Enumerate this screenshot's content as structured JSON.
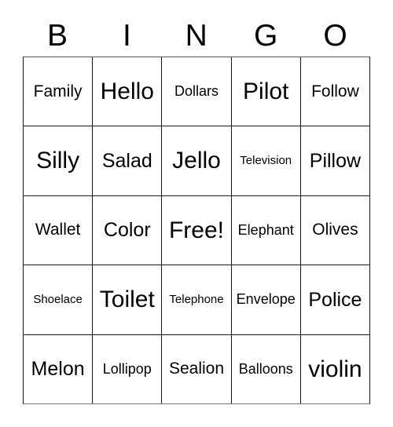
{
  "card": {
    "title": "BINGO",
    "headers": [
      {
        "label": "B"
      },
      {
        "label": "I"
      },
      {
        "label": "N"
      },
      {
        "label": "G"
      },
      {
        "label": "O"
      }
    ],
    "rows": [
      {
        "cells": [
          {
            "label": "Family",
            "size": "m"
          },
          {
            "label": "Hello",
            "size": "xl"
          },
          {
            "label": "Dollars",
            "size": "s"
          },
          {
            "label": "Pilot",
            "size": "xl"
          },
          {
            "label": "Follow",
            "size": "m"
          }
        ]
      },
      {
        "cells": [
          {
            "label": "Silly",
            "size": "xl"
          },
          {
            "label": "Salad",
            "size": "l"
          },
          {
            "label": "Jello",
            "size": "xl"
          },
          {
            "label": "Television",
            "size": "xs"
          },
          {
            "label": "Pillow",
            "size": "l"
          }
        ]
      },
      {
        "cells": [
          {
            "label": "Wallet",
            "size": "m"
          },
          {
            "label": "Color",
            "size": "l"
          },
          {
            "label": "Free!",
            "size": "xl"
          },
          {
            "label": "Elephant",
            "size": "s"
          },
          {
            "label": "Olives",
            "size": "m"
          }
        ]
      },
      {
        "cells": [
          {
            "label": "Shoelace",
            "size": "xs"
          },
          {
            "label": "Toilet",
            "size": "xl"
          },
          {
            "label": "Telephone",
            "size": "xs"
          },
          {
            "label": "Envelope",
            "size": "s"
          },
          {
            "label": "Police",
            "size": "l"
          }
        ]
      },
      {
        "cells": [
          {
            "label": "Melon",
            "size": "l"
          },
          {
            "label": "Lollipop",
            "size": "s"
          },
          {
            "label": "Sealion",
            "size": "m"
          },
          {
            "label": "Balloons",
            "size": "s"
          },
          {
            "label": "violin",
            "size": "xl"
          }
        ]
      }
    ]
  },
  "colors": {
    "background": "#ffffff",
    "text": "#000000",
    "grid_line": "#1a1a1a"
  }
}
